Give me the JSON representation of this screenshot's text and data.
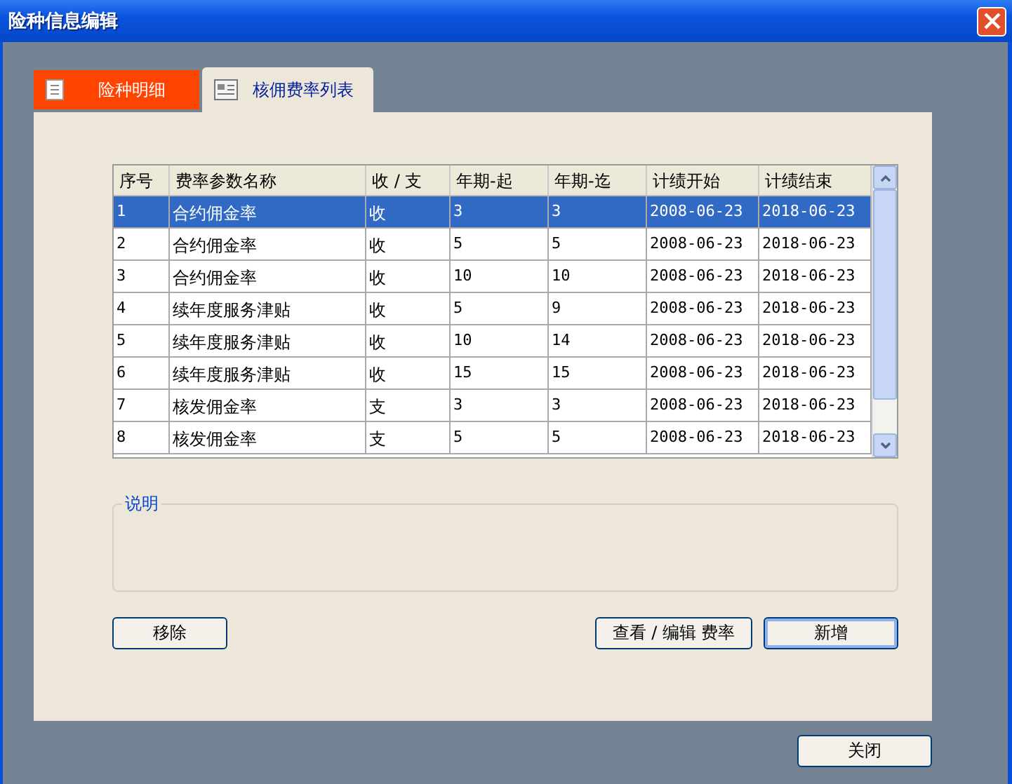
{
  "window": {
    "title": "险种信息编辑"
  },
  "tabs": [
    {
      "label": "险种明细",
      "selected": false
    },
    {
      "label": "核佣费率列表",
      "selected": true
    }
  ],
  "table": {
    "columns": [
      "序号",
      "费率参数名称",
      "收 / 支",
      "年期-起",
      "年期-迄",
      "计绩开始",
      "计绩结束"
    ],
    "rows": [
      {
        "selected": true,
        "cells": [
          "1",
          "合约佣金率",
          "收",
          "3",
          "3",
          "2008-06-23",
          "2018-06-23"
        ]
      },
      {
        "selected": false,
        "cells": [
          "2",
          "合约佣金率",
          "收",
          "5",
          "5",
          "2008-06-23",
          "2018-06-23"
        ]
      },
      {
        "selected": false,
        "cells": [
          "3",
          "合约佣金率",
          "收",
          "10",
          "10",
          "2008-06-23",
          "2018-06-23"
        ]
      },
      {
        "selected": false,
        "cells": [
          "4",
          "续年度服务津贴",
          "收",
          "5",
          "9",
          "2008-06-23",
          "2018-06-23"
        ]
      },
      {
        "selected": false,
        "cells": [
          "5",
          "续年度服务津贴",
          "收",
          "10",
          "14",
          "2008-06-23",
          "2018-06-23"
        ]
      },
      {
        "selected": false,
        "cells": [
          "6",
          "续年度服务津贴",
          "收",
          "15",
          "15",
          "2008-06-23",
          "2018-06-23"
        ]
      },
      {
        "selected": false,
        "cells": [
          "7",
          "核发佣金率",
          "支",
          "3",
          "3",
          "2008-06-23",
          "2018-06-23"
        ]
      },
      {
        "selected": false,
        "cells": [
          "8",
          "核发佣金率",
          "支",
          "5",
          "5",
          "2008-06-23",
          "2018-06-23"
        ]
      }
    ]
  },
  "description": {
    "legend": "说明"
  },
  "buttons_left": [
    "移除"
  ],
  "buttons_right": [
    {
      "label": "查看 / 编辑 费率",
      "focused": false
    },
    {
      "label": "新增",
      "focused": true
    }
  ],
  "footer_button": "关闭"
}
